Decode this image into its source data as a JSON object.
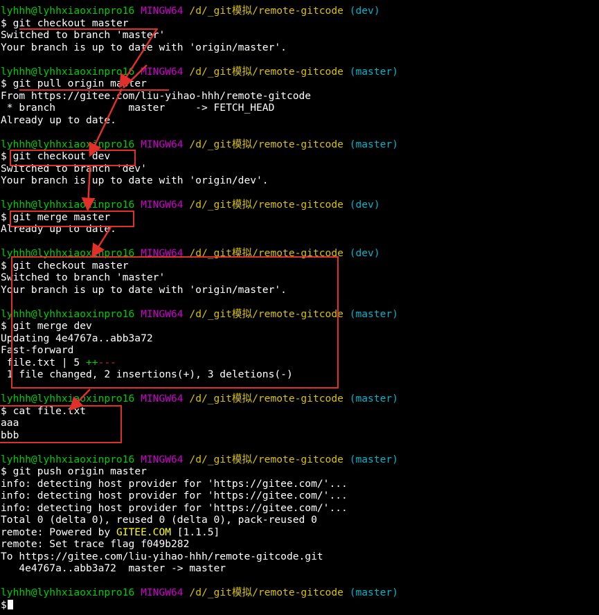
{
  "prompt": {
    "user": "lyhhh@lyhhxiaoxinpro16",
    "system": "MINGW64",
    "path": "/d/_git模拟/remote-gitcode",
    "dollar": "$"
  },
  "lines": [
    {
      "kind": "prompt",
      "branch": "(dev)"
    },
    {
      "kind": "cmd",
      "text": "git checkout master"
    },
    {
      "kind": "out",
      "text": "Switched to branch 'master'"
    },
    {
      "kind": "out",
      "text": "Your branch is up to date with 'origin/master'."
    },
    {
      "kind": "blank"
    },
    {
      "kind": "prompt",
      "branch": "(master)"
    },
    {
      "kind": "cmd",
      "text": "git pull origin master"
    },
    {
      "kind": "out",
      "text": "From https://gitee.com/liu-yihao-hhh/remote-gitcode"
    },
    {
      "kind": "out",
      "text": " * branch            master     -> FETCH_HEAD"
    },
    {
      "kind": "out",
      "text": "Already up to date."
    },
    {
      "kind": "blank"
    },
    {
      "kind": "prompt",
      "branch": "(master)"
    },
    {
      "kind": "cmd",
      "text": "git checkout dev"
    },
    {
      "kind": "out",
      "text": "Switched to branch 'dev'"
    },
    {
      "kind": "out",
      "text": "Your branch is up to date with 'origin/dev'."
    },
    {
      "kind": "blank"
    },
    {
      "kind": "prompt",
      "branch": "(dev)"
    },
    {
      "kind": "cmd",
      "text": "git merge master"
    },
    {
      "kind": "out",
      "text": "Already up to date."
    },
    {
      "kind": "blank"
    },
    {
      "kind": "prompt",
      "branch": "(dev)"
    },
    {
      "kind": "cmd",
      "text": "git checkout master"
    },
    {
      "kind": "out",
      "text": "Switched to branch 'master'"
    },
    {
      "kind": "out",
      "text": "Your branch is up to date with 'origin/master'."
    },
    {
      "kind": "blank"
    },
    {
      "kind": "prompt",
      "branch": "(master)"
    },
    {
      "kind": "cmd",
      "text": "git merge dev"
    },
    {
      "kind": "out",
      "text": "Updating 4e4767a..abb3a72"
    },
    {
      "kind": "out",
      "text": "Fast-forward"
    },
    {
      "kind": "stat",
      "file": " file.txt | 5 ",
      "plus": "++",
      "minus": "---"
    },
    {
      "kind": "out",
      "text": " 1 file changed, 2 insertions(+), 3 deletions(-)"
    },
    {
      "kind": "blank"
    },
    {
      "kind": "prompt",
      "branch": "(master)"
    },
    {
      "kind": "cmd",
      "text": "cat file.txt"
    },
    {
      "kind": "out",
      "text": "aaa"
    },
    {
      "kind": "out",
      "text": "bbb"
    },
    {
      "kind": "blank"
    },
    {
      "kind": "prompt",
      "branch": "(master)"
    },
    {
      "kind": "cmd",
      "text": "git push origin master"
    },
    {
      "kind": "out",
      "text": "info: detecting host provider for 'https://gitee.com/'..."
    },
    {
      "kind": "out",
      "text": "info: detecting host provider for 'https://gitee.com/'..."
    },
    {
      "kind": "out",
      "text": "info: detecting host provider for 'https://gitee.com/'..."
    },
    {
      "kind": "out",
      "text": "Total 0 (delta 0), reused 0 (delta 0), pack-reused 0"
    },
    {
      "kind": "remote",
      "pre": "remote: Powered by ",
      "highlight": "GITEE.COM",
      "post": " [1.1.5]"
    },
    {
      "kind": "out",
      "text": "remote: Set trace flag f049b282"
    },
    {
      "kind": "out",
      "text": "To https://gitee.com/liu-yihao-hhh/remote-gitcode.git"
    },
    {
      "kind": "out",
      "text": "   4e4767a..abb3a72  master -> master"
    },
    {
      "kind": "blank"
    },
    {
      "kind": "prompt",
      "branch": "(master)"
    },
    {
      "kind": "input",
      "text": ""
    }
  ],
  "colors": {
    "background": "#000000",
    "user": "#00cc00",
    "system": "#cc00cc",
    "path": "#d8c200",
    "branch": "#00b4c8",
    "annotation": "#e0302a"
  }
}
